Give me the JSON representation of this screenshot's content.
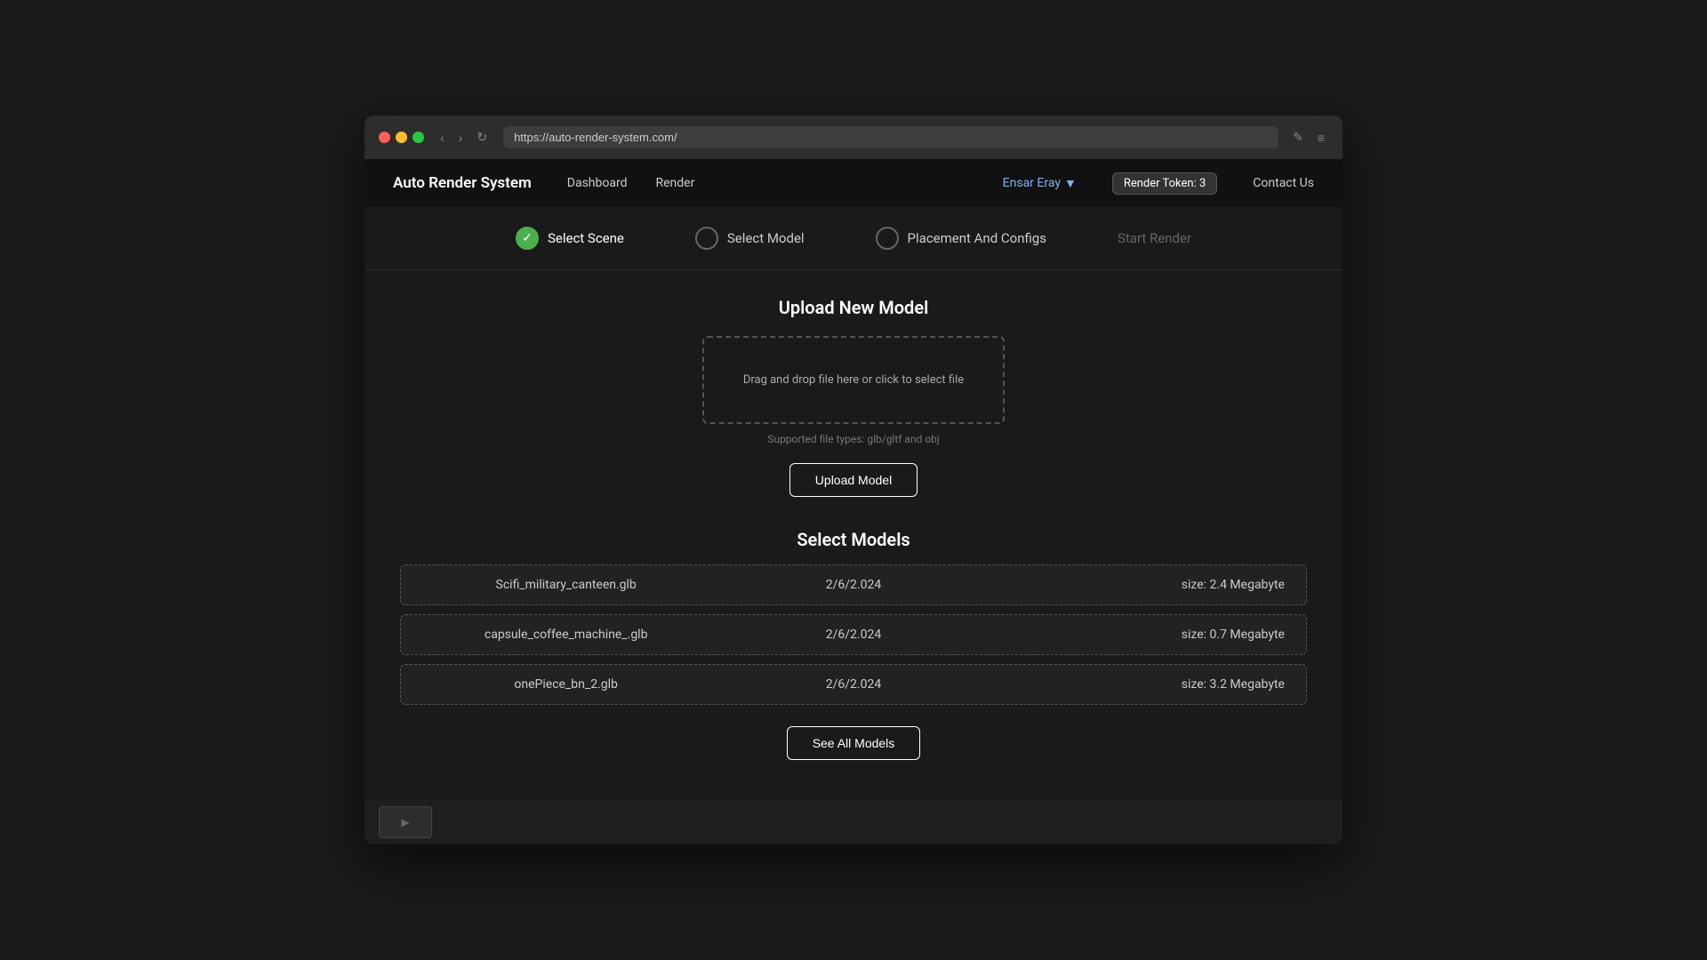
{
  "browser": {
    "url": "https://auto-render-system.com/",
    "back_label": "‹",
    "forward_label": "›",
    "reload_label": "↻",
    "edit_icon": "✎",
    "menu_icon": "≡"
  },
  "nav": {
    "logo": "Auto Render System",
    "links": [
      {
        "id": "dashboard",
        "label": "Dashboard",
        "active": false
      },
      {
        "id": "render",
        "label": "Render",
        "active": false
      }
    ],
    "user": {
      "name": "Ensar Eray",
      "dropdown_icon": "▼"
    },
    "token_label": "Render Token: 3",
    "contact_label": "Contact Us"
  },
  "steps": [
    {
      "id": "select-scene",
      "label": "Select Scene",
      "status": "completed"
    },
    {
      "id": "select-model",
      "label": "Select Model",
      "status": "active"
    },
    {
      "id": "placement",
      "label": "Placement And Configs",
      "status": "inactive"
    },
    {
      "id": "start-render",
      "label": "Start Render",
      "status": "inactive"
    }
  ],
  "upload_section": {
    "title": "Upload New Model",
    "dropzone_text": "Drag and drop file here or click to select file",
    "supported_types": "Supported file types: glb/gltf and obj",
    "upload_button_label": "Upload Model"
  },
  "models_section": {
    "title": "Select Models",
    "models": [
      {
        "name": "Scifi_military_canteen.glb",
        "date": "2/6/2.024",
        "size": "size: 2.4 Megabyte"
      },
      {
        "name": "capsule_coffee_machine_.glb",
        "date": "2/6/2.024",
        "size": "size: 0.7 Megabyte"
      },
      {
        "name": "onePiece_bn_2.glb",
        "date": "2/6/2.024",
        "size": "size: 3.2 Megabyte"
      }
    ],
    "see_all_button_label": "See All Models"
  }
}
